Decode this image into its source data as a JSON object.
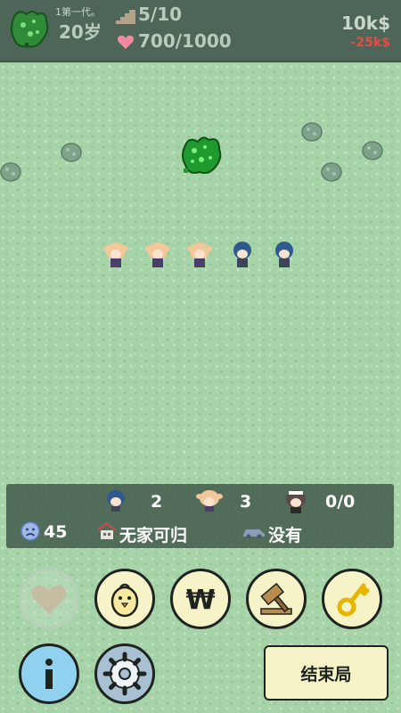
{
  "header": {
    "generation_label": "1第一代。",
    "age": "20岁",
    "floor": "5/10",
    "hp": "700/1000",
    "money": "10k$",
    "money_delta": "-25k$",
    "money_delta_color": "#e84a4a",
    "icons": [
      "slime-avatar-icon",
      "stairs-icon",
      "heart-icon"
    ]
  },
  "field": {
    "boss": "green-slime-icon",
    "bushes": 6,
    "units": [
      "blonde-girl",
      "blonde-girl",
      "blonde-girl",
      "blue-hair-boy",
      "blue-hair-boy"
    ]
  },
  "status_panel": {
    "boys_count": "2",
    "girls_count": "3",
    "maid_count": "0/0",
    "mood": "45",
    "home": "无家可归",
    "vehicle": "没有"
  },
  "actions": {
    "buttons": [
      "heart-button",
      "chick-button",
      "won-button",
      "gavel-button",
      "key-button",
      "info-button",
      "settings-button"
    ],
    "end_label": "结束局"
  }
}
